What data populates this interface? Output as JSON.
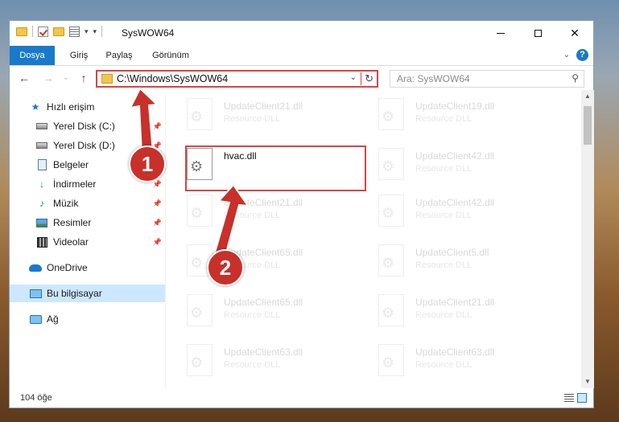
{
  "window": {
    "title": "SysWOW64",
    "caption": {
      "minimize": "",
      "maximize": "",
      "close": "✕"
    }
  },
  "ribbon": {
    "tabs": [
      {
        "label": "Dosya"
      },
      {
        "label": "Giriş"
      },
      {
        "label": "Paylaş"
      },
      {
        "label": "Görünüm"
      }
    ],
    "help": "?"
  },
  "nav": {
    "back": "←",
    "forward": "→",
    "recent": "⌄",
    "up": "↑",
    "address": "C:\\Windows\\SysWOW64",
    "search_placeholder": "Ara: SysWOW64"
  },
  "sidebar": {
    "items": [
      {
        "label": "Hızlı erişim"
      },
      {
        "label": "Yerel Disk (C:)"
      },
      {
        "label": "Yerel Disk (D:)"
      },
      {
        "label": "Belgeler"
      },
      {
        "label": "İndirmeler"
      },
      {
        "label": "Müzik"
      },
      {
        "label": "Resimler"
      },
      {
        "label": "Videolar"
      },
      {
        "label": "OneDrive"
      },
      {
        "label": "Bu bilgisayar"
      },
      {
        "label": "Ağ"
      }
    ]
  },
  "files": {
    "left": [
      {
        "name": "UpdateClient21.dll",
        "type": "Resource DLL"
      },
      {
        "name": "hvac.dll",
        "type": ""
      },
      {
        "name": "UpdateClient21.dll",
        "type": "Resource DLL"
      },
      {
        "name": "UpdateClient65.dll",
        "type": "Resource DLL"
      },
      {
        "name": "UpdateClient65.dll",
        "type": "Resource DLL"
      },
      {
        "name": "UpdateClient63.dll",
        "type": "Resource DLL"
      }
    ],
    "right": [
      {
        "name": "UpdateClient19.dll",
        "type": "Resource DLL"
      },
      {
        "name": "UpdateClient42.dll",
        "type": "Resource DLL"
      },
      {
        "name": "UpdateClient42.dll",
        "type": "Resource DLL"
      },
      {
        "name": "UpdateClient5.dll",
        "type": "Resource DLL"
      },
      {
        "name": "UpdateClient21.dll",
        "type": "Resource DLL"
      },
      {
        "name": "UpdateClient63.dll",
        "type": "Resource DLL"
      }
    ]
  },
  "status": {
    "count": "104 öğe"
  },
  "annotations": {
    "step1": "1",
    "step2": "2"
  },
  "colors": {
    "accent": "#1979ca",
    "highlight": "#d64545",
    "badge": "#c8302a"
  }
}
